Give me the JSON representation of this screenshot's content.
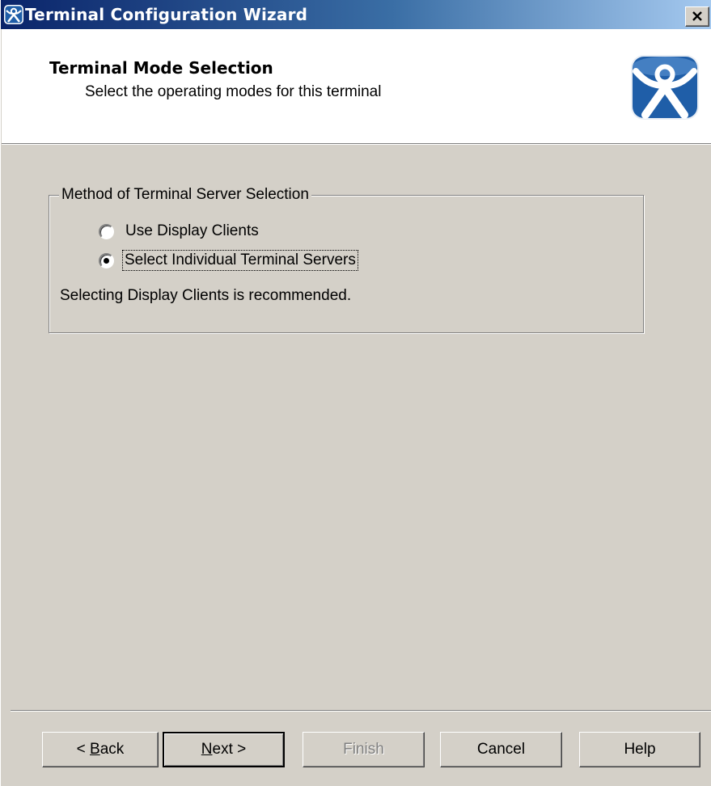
{
  "window": {
    "title": "Terminal Configuration Wizard",
    "close_symbol": "×"
  },
  "header": {
    "title": "Terminal Mode Selection",
    "subtitle": "Select the operating modes for this terminal",
    "logo_icon": "thinmanager-person-icon"
  },
  "group": {
    "legend": "Method of Terminal Server Selection",
    "options": [
      {
        "label": "Use Display Clients",
        "selected": false
      },
      {
        "label": "Select Individual Terminal Servers",
        "selected": true
      }
    ],
    "hint": "Selecting Display Clients is recommended."
  },
  "buttons": {
    "back_prefix": "< ",
    "back_mnemonic": "B",
    "back_rest": "ack",
    "next_mnemonic": "N",
    "next_rest": "ext >",
    "finish": "Finish",
    "cancel": "Cancel",
    "help": "Help"
  },
  "colors": {
    "titlebar_start": "#0a246a",
    "titlebar_end": "#a6caf0",
    "dialog_face": "#d4d0c8",
    "logo_blue": "#1f5ea8"
  }
}
